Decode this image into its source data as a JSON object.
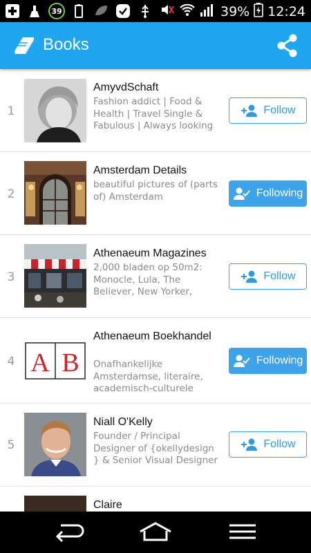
{
  "status_bar": {
    "notif_count": "39",
    "battery": "39%",
    "time": "12:24"
  },
  "app_bar": {
    "title": "Books",
    "icon": "book-icon",
    "action_icon": "share-icon"
  },
  "colors": {
    "accent": "#1ea6f0",
    "follow_border": "#3ba3e6",
    "following_bg": "#3ea4ea"
  },
  "list": [
    {
      "rank": "1",
      "name": "AmyvdSchaft",
      "desc": "Fashion addict | Food & Health | Travel Single & Fabulous | Always looking",
      "button": "Follow",
      "state": "follow"
    },
    {
      "rank": "2",
      "name": "Amsterdam Details",
      "desc": "beautiful pictures of (parts of) Amsterdam",
      "button": "Following",
      "state": "following"
    },
    {
      "rank": "3",
      "name": "Athenaeum Magazines",
      "desc": "2,000 bladen op 50m2: Monocle, Lula, The Believer, New Yorker,",
      "button": "Follow",
      "state": "follow"
    },
    {
      "rank": "4",
      "name": "Athenaeum Boekhandel",
      "desc": "Onafhankelijke Amsterdamse, literaire, academisch-culturele",
      "button": "Following",
      "state": "following",
      "logo": "AB"
    },
    {
      "rank": "5",
      "name": "Niall O'Kelly",
      "desc": "Founder / Principal Designer of {okellydesign } & Senior Visual Designer",
      "button": "Follow",
      "state": "follow"
    },
    {
      "rank": "",
      "name": "Claire",
      "desc": "",
      "button": "",
      "state": "none"
    }
  ],
  "nav_bar": {
    "back": "back-icon",
    "home": "home-icon",
    "menu": "menu-icon"
  }
}
